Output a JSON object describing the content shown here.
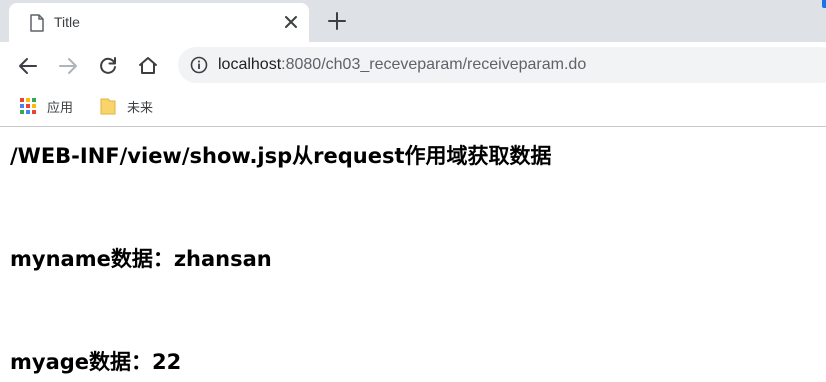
{
  "tab": {
    "title": "Title",
    "page_icon": "document-icon",
    "close_icon": "close-icon",
    "new_tab_icon": "plus-icon"
  },
  "toolbar": {
    "back_icon": "back-arrow-icon",
    "forward_icon": "forward-arrow-icon",
    "reload_icon": "reload-icon",
    "home_icon": "home-icon",
    "info_icon": "info-icon",
    "url_host": "localhost",
    "url_rest": ":8080/ch03_receveparam/receiveparam.do"
  },
  "bookmarks": [
    {
      "label": "应用",
      "icon": "apps-grid-icon"
    },
    {
      "label": "未来",
      "icon": "folder-icon"
    }
  ],
  "content": {
    "heading": "/WEB-INF/view/show.jsp从request作用域获取数据",
    "myname_line": "myname数据：zhansan",
    "myage_line": "myage数据：22"
  },
  "colors": {
    "tab_strip": "#dee1e6",
    "omnibox": "#f1f3f4",
    "accent": "#1a73e8",
    "apps_grid": [
      "#ea4335",
      "#fbbc04",
      "#34a853",
      "#4285f4"
    ],
    "folder": "#f9d46b"
  }
}
